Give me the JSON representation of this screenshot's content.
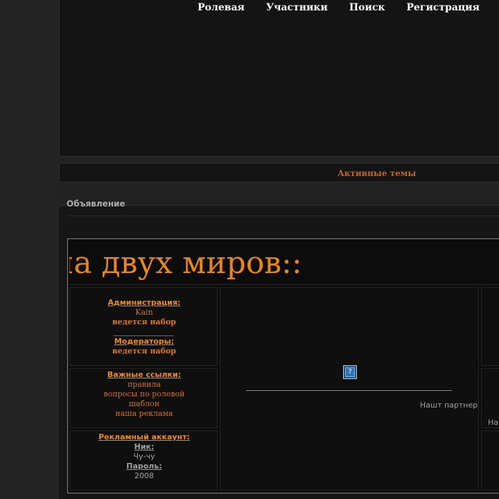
{
  "nav": {
    "roleplay": "Ролевая",
    "members": "Участники",
    "search": "Поиск",
    "register": "Регистрация"
  },
  "active_topics": "Активные темы",
  "announcement": {
    "label": "Объявление",
    "banner_text": "на двух миров::",
    "admin": {
      "title": "Администрация:",
      "name": "Kain",
      "recruiting": "ведется набор"
    },
    "moderators": {
      "title": "Модераторы:",
      "recruiting": "ведется набор"
    },
    "links": {
      "title": "Важные ссылки:",
      "items": [
        "правила",
        "вопросы по ролевой",
        "шаблон",
        "наша реклама"
      ]
    },
    "ad_account": {
      "title": "Рекламный аккаунт:",
      "nick_label": "Ник:",
      "nick_value": "Чу-чу",
      "password_label": "Пароль:",
      "password_value": "2008"
    },
    "partner_text": "Нашт партнер",
    "partner_text_clipped": "На"
  },
  "colors": {
    "accent_orange": "#e8851c",
    "link_orange": "#d2702a",
    "background": "#222222",
    "panel_dark": "#0c0c0c"
  },
  "icons": {
    "broken_image": "broken-image-icon"
  }
}
